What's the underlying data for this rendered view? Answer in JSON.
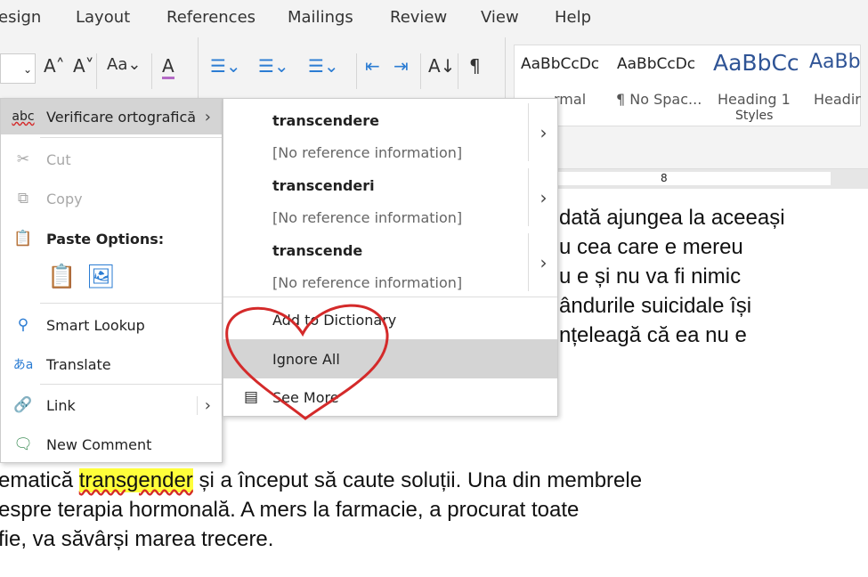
{
  "tabs": [
    "esign",
    "Layout",
    "References",
    "Mailings",
    "Review",
    "View",
    "Help"
  ],
  "toolbar": {
    "grow_font": "A˄",
    "shrink_font": "A˅",
    "change_case": "Aa⌄",
    "clear_format": "A",
    "bullets": "☰⌄",
    "numbering": "☰⌄",
    "multilevel": "☰⌄",
    "decrease_indent": "⇤",
    "increase_indent": "⇥",
    "sort": "A↓",
    "show_marks": "¶"
  },
  "styles": {
    "items": [
      {
        "preview": "AaBbCcDc",
        "name": "rmal"
      },
      {
        "preview": "AaBbCcDc",
        "name": "¶ No Spac..."
      },
      {
        "preview": "AaBbCc",
        "name": "Heading 1"
      },
      {
        "preview": "AaBb",
        "name": "Headir"
      }
    ],
    "group_label": "Styles"
  },
  "ruler": {
    "mark": "8"
  },
  "document": {
    "right_lines": [
      "dată ajungea la aceeași",
      "u cea care e mereu",
      "u e și nu va fi nimic",
      "ândurile suicidale își",
      "nțeleagă că ea nu e"
    ],
    "line1_before": "ematică ",
    "line1_highlight": "transgender",
    "line1_after": " și a început să caute soluții. Una din membrele",
    "line2": "espre terapia hormonală. A mers la farmacie, a procurat toate",
    "line3": " fie, va săvârși marea trecere."
  },
  "context_menu": {
    "spelling": "Verificare ortografică",
    "cut": "Cut",
    "copy": "Copy",
    "paste_options": "Paste Options:",
    "smart_lookup": "Smart Lookup",
    "translate": "Translate",
    "link": "Link",
    "new_comment": "New Comment"
  },
  "spelling_submenu": {
    "suggestions": [
      {
        "word": "transcendere",
        "ref": "[No reference information]"
      },
      {
        "word": "transcenderi",
        "ref": "[No reference information]"
      },
      {
        "word": "transcende",
        "ref": "[No reference information]"
      }
    ],
    "add_to_dictionary": "Add to Dictionary",
    "ignore_all": "Ignore All",
    "see_more": "See More"
  },
  "colors": {
    "heading_blue": "#2f5496",
    "highlight": "#ffff3a",
    "annotation_heart": "#d42a2a",
    "menu_hover": "#d4d4d4"
  }
}
